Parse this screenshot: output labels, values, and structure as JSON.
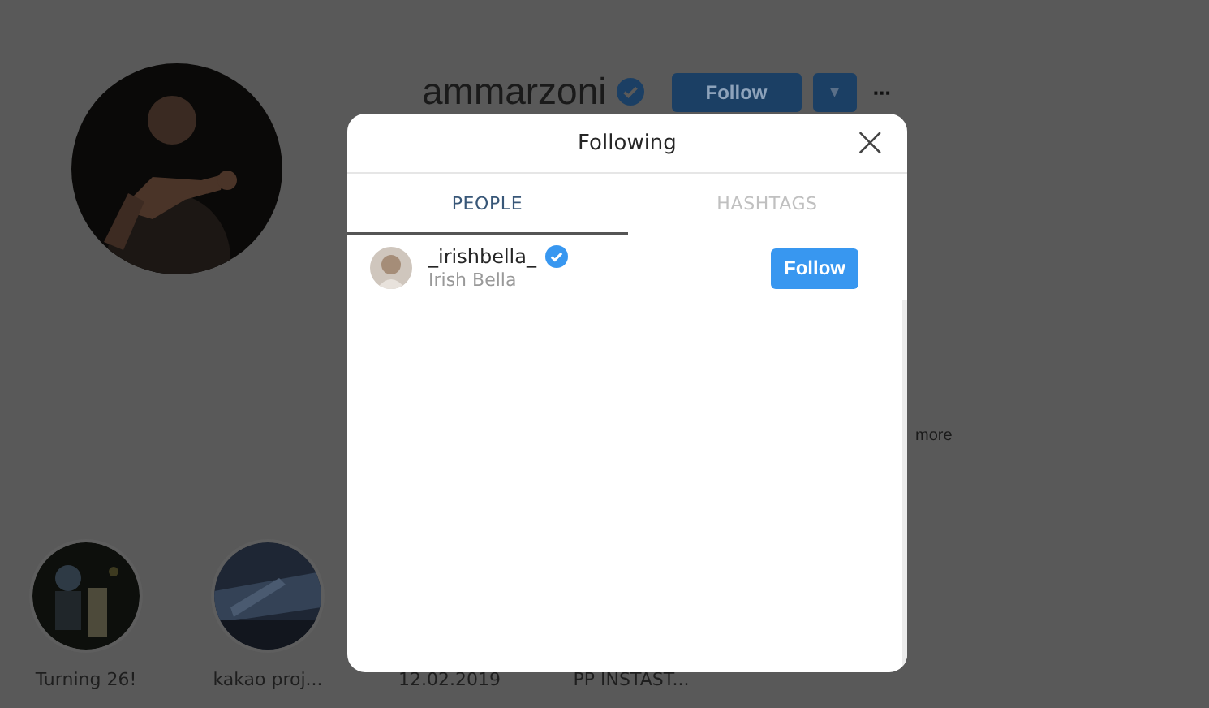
{
  "profile": {
    "username": "ammarzoni",
    "verified": true,
    "follow_button": "Follow",
    "dropdown_icon": "▾",
    "more_icon": "···",
    "bio_more": "more"
  },
  "highlights": [
    {
      "label": "Turning 26!",
      "picture": true
    },
    {
      "label": "kakao proj...",
      "picture": true
    },
    {
      "label": "12.02.2019"
    },
    {
      "label": "PP INSTAST..."
    }
  ],
  "modal": {
    "title": "Following",
    "close_icon": "×",
    "tabs": [
      {
        "label": "PEOPLE",
        "selected": true
      },
      {
        "label": "HASHTAGS",
        "selected": false
      }
    ],
    "people": [
      {
        "username": "_irishbella_",
        "name": "Irish Bella",
        "verified": true,
        "button": "Follow"
      }
    ]
  }
}
